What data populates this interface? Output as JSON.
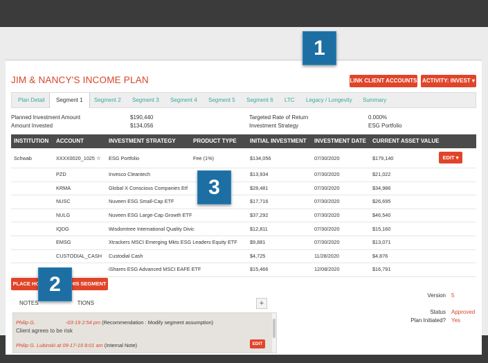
{
  "plan": {
    "title": "JIM & NANCY'S INCOME PLAN"
  },
  "header_buttons": {
    "link_clients": "LINK CLIENT ACCOUNTS",
    "activity": "ACTIVITY: INVEST"
  },
  "tabs": [
    {
      "label": "Plan Detail"
    },
    {
      "label": "Segment 1"
    },
    {
      "label": "Segment 2"
    },
    {
      "label": "Segment 3"
    },
    {
      "label": "Segment 4"
    },
    {
      "label": "Segment 5"
    },
    {
      "label": "Segment 6"
    },
    {
      "label": "LTC"
    },
    {
      "label": "Legacy / Longevity"
    },
    {
      "label": "Summary"
    }
  ],
  "summary": {
    "planned_label": "Planned Investment Amount",
    "planned_value": "$190,440",
    "invested_label": "Amount Invested",
    "invested_value": "$134,056",
    "rate_label": "Targeted Rate of Return",
    "rate_value": "0.000%",
    "strategy_label": "Investment Strategy",
    "strategy_value": "ESG Portfolio"
  },
  "table": {
    "headers": [
      "INSTITUTION",
      "ACCOUNT",
      "INVESTMENT STRATEGY",
      "PRODUCT TYPE",
      "INITIAL INVESTMENT",
      "INVESTMENT DATE",
      "CURRENT ASSET VALUE"
    ],
    "rows": [
      {
        "institution": "Schwab",
        "account": "XXXX0020_1025 ☆",
        "strategy": "ESG Portfolio",
        "product": "Fee (1%)",
        "initial": "$134,056",
        "date": "07/30/2020",
        "value": "$179,140"
      },
      {
        "institution": "",
        "account": "PZD",
        "strategy": "Invesco Cleantech",
        "product": "",
        "initial": "$13,934",
        "date": "07/30/2020",
        "value": "$21,022"
      },
      {
        "institution": "",
        "account": "KRMA",
        "strategy": "Global X Conscious Companies Etf",
        "product": "",
        "initial": "$28,481",
        "date": "07/30/2020",
        "value": "$34,986"
      },
      {
        "institution": "",
        "account": "NUSC",
        "strategy": "Nuveen ESG Small-Cap ETF",
        "product": "",
        "initial": "$17,716",
        "date": "07/30/2020",
        "value": "$26,695"
      },
      {
        "institution": "",
        "account": "NULG",
        "strategy": "Nuveen ESG Large-Cap Growth ETF",
        "product": "",
        "initial": "$37,292",
        "date": "07/30/2020",
        "value": "$46,540"
      },
      {
        "institution": "",
        "account": "IQDG",
        "strategy": "Wisdomtree International Quality Divic",
        "product": "",
        "initial": "$12,811",
        "date": "07/30/2020",
        "value": "$15,160"
      },
      {
        "institution": "",
        "account": "EMSG",
        "strategy": "Xtrackers MSCI Emerging Mkts ESG Leaders Equity ETF",
        "product": "",
        "initial": "$9,881",
        "date": "07/30/2020",
        "value": "$13,071"
      },
      {
        "institution": "",
        "account": "CUSTODIAL_CASH",
        "strategy": "Custodial Cash",
        "product": "",
        "initial": "$4,725",
        "date": "11/28/2020",
        "value": "$4,876"
      },
      {
        "institution": "",
        "account": "DMXF",
        "strategy": "iShares ESG Advanced MSCI EAFE ETF",
        "product": "",
        "initial": "$15,466",
        "date": "12/08/2020",
        "value": "$16,791"
      }
    ],
    "edit_label": "EDIT"
  },
  "place_holdings_label": "PLACE HOLDINGS IN THIS SEGMENT",
  "notes": {
    "tab_prefix": "NOTES",
    "tab_suffix": "TIONS",
    "add_label": "+",
    "entries": [
      {
        "author": "Philip G.",
        "date": "-03-19 2:54 pm",
        "type": "(Recommendation : Modify segment assumption)",
        "body": "Client agrees to be risk"
      },
      {
        "author": "Philip G. Lubinski at 09-17-19 8:01 am",
        "type": "(Internal Note)"
      }
    ],
    "edit_label": "EDIT"
  },
  "status_panel": {
    "version_label": "Version",
    "version_value": "5",
    "status_label": "Status",
    "status_value": "Approved",
    "initiated_label": "Plan Initiated?",
    "initiated_value": "Yes"
  },
  "callouts": [
    "1",
    "2",
    "3"
  ],
  "colors": {
    "accent": "#e0452a",
    "tab_teal": "#3aa8a0",
    "header_dark": "#4b4b4b",
    "callout_blue": "#1d6fa3"
  }
}
